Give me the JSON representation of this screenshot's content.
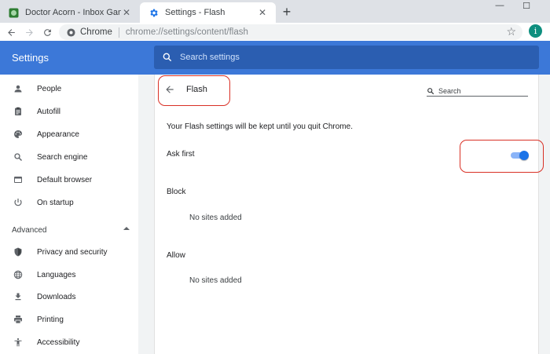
{
  "browser": {
    "tabs": [
      {
        "title": "Doctor Acorn - Inbox Games",
        "active": false
      },
      {
        "title": "Settings - Flash",
        "active": true
      }
    ],
    "new_tab_symbol": "+",
    "tab_close_symbol": "✕",
    "window_controls": {
      "minimize": "—",
      "maximize": "☐"
    },
    "omnibox": {
      "site_name": "Chrome",
      "url_scheme": "chrome://",
      "url_path": "settings/content/flash"
    },
    "profile_initial": "i",
    "icons": {
      "back": "arrow-left-icon",
      "forward": "arrow-right-icon",
      "reload": "reload-icon",
      "bookmark": "star-icon"
    }
  },
  "settings": {
    "app_title": "Settings",
    "search_placeholder": "Search settings",
    "header_color": "#3c78d8",
    "sidebar": {
      "items": [
        {
          "label": "People",
          "icon": "person-icon"
        },
        {
          "label": "Autofill",
          "icon": "clipboard-icon"
        },
        {
          "label": "Appearance",
          "icon": "palette-icon"
        },
        {
          "label": "Search engine",
          "icon": "search-icon"
        },
        {
          "label": "Default browser",
          "icon": "browser-window-icon"
        },
        {
          "label": "On startup",
          "icon": "power-icon"
        }
      ],
      "advanced_label": "Advanced",
      "advanced_items": [
        {
          "label": "Privacy and security",
          "icon": "shield-icon"
        },
        {
          "label": "Languages",
          "icon": "globe-icon"
        },
        {
          "label": "Downloads",
          "icon": "download-icon"
        },
        {
          "label": "Printing",
          "icon": "printer-icon"
        },
        {
          "label": "Accessibility",
          "icon": "accessibility-icon"
        }
      ]
    },
    "page": {
      "title": "Flash",
      "search_placeholder": "Search",
      "description": "Your Flash settings will be kept until you quit Chrome.",
      "ask_first_label": "Ask first",
      "ask_first_enabled": true,
      "block_header": "Block",
      "block_empty": "No sites added",
      "allow_header": "Allow",
      "allow_empty": "No sites added"
    },
    "accent_color": "#1a73e8",
    "annotation_color": "#d93025"
  }
}
